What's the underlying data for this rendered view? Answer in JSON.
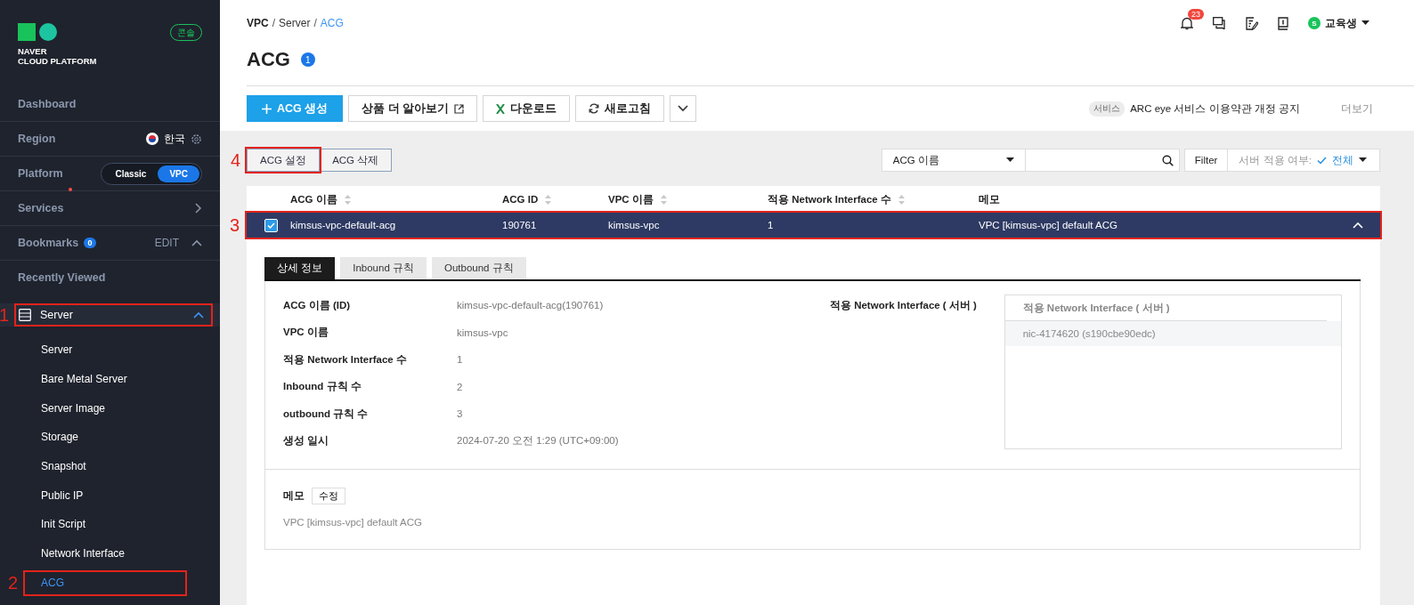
{
  "sidebar": {
    "logo": {
      "line1": "NAVER",
      "line2": "CLOUD PLATFORM"
    },
    "badge": "콘솔",
    "nav": [
      {
        "kind": "link",
        "label": "Dashboard"
      },
      {
        "kind": "region",
        "label": "Region",
        "value": "한국"
      },
      {
        "kind": "toggle",
        "label": "Platform",
        "options": [
          {
            "label": "Classic",
            "selected": false
          },
          {
            "label": "VPC",
            "selected": true
          }
        ]
      },
      {
        "kind": "services",
        "label": "Services",
        "dot": true
      },
      {
        "kind": "bookmarks",
        "label": "Bookmarks",
        "count": "0",
        "action": "EDIT",
        "expanded": true
      },
      {
        "kind": "heading",
        "label": "Recently Viewed"
      }
    ],
    "menu": {
      "label": "Server",
      "expanded": true,
      "annotation": "1",
      "children": [
        {
          "label": "Server",
          "selected": false
        },
        {
          "label": "Bare Metal Server",
          "selected": false
        },
        {
          "label": "Server Image",
          "selected": false
        },
        {
          "label": "Storage",
          "selected": false
        },
        {
          "label": "Snapshot",
          "selected": false
        },
        {
          "label": "Public IP",
          "selected": false
        },
        {
          "label": "Init Script",
          "selected": false
        },
        {
          "label": "Network Interface",
          "selected": false
        },
        {
          "label": "ACG",
          "selected": true,
          "annotation": "2"
        }
      ]
    }
  },
  "header": {
    "breadcrumb": [
      {
        "label": "VPC",
        "kind": "root",
        "separator": "/"
      },
      {
        "label": "Server",
        "kind": "link",
        "separator": "/"
      },
      {
        "label": "ACG",
        "kind": "current"
      }
    ],
    "title": "ACG",
    "count": "1",
    "notifications": "23",
    "user": {
      "initial": "S",
      "name": "교육생"
    }
  },
  "toolbar": {
    "buttons": [
      {
        "kind": "primary",
        "label": "ACG 생성"
      },
      {
        "kind": "external",
        "label": "상품 더 알아보기"
      },
      {
        "kind": "excel",
        "label": "다운로드"
      },
      {
        "kind": "refresh",
        "label": "새로고침"
      },
      {
        "kind": "more"
      }
    ],
    "notice": {
      "tag": "서비스",
      "text": "ARC eye 서비스 이용약관 개정 공지",
      "more": "더보기"
    }
  },
  "actions": [
    {
      "label": "ACG 설정",
      "annotation": "4"
    },
    {
      "label": "ACG 삭제"
    }
  ],
  "search": {
    "select": "ACG 이름",
    "filter": "Filter",
    "filter_label": "서버 적용 여부:",
    "filter_value": "전체"
  },
  "table": {
    "columns": [
      {
        "label": "ACG 이름",
        "sortable": true
      },
      {
        "label": "ACG ID",
        "sortable": true
      },
      {
        "label": "VPC 이름",
        "sortable": true
      },
      {
        "label": "적용 Network Interface 수",
        "sortable": true
      },
      {
        "label": "메모",
        "sortable": false
      }
    ],
    "rows": [
      {
        "checked": true,
        "selected": true,
        "expanded": true,
        "annotation": "3",
        "cells": [
          "kimsus-vpc-default-acg",
          "190761",
          "kimsus-vpc",
          "1",
          "VPC [kimsus-vpc] default ACG"
        ]
      }
    ]
  },
  "detail": {
    "tabs": [
      {
        "label": "상세 정보",
        "selected": true
      },
      {
        "label": "Inbound 규칙",
        "selected": false
      },
      {
        "label": "Outbound 규칙",
        "selected": false
      }
    ],
    "fields": [
      {
        "label": "ACG 이름 (ID)",
        "value": "kimsus-vpc-default-acg(190761)"
      },
      {
        "label": "VPC 이름",
        "value": "kimsus-vpc"
      },
      {
        "label": "적용 Network Interface 수",
        "value": "1"
      },
      {
        "label": "Inbound 규칙 수",
        "value": "2"
      },
      {
        "label": "outbound 규칙 수",
        "value": "3"
      },
      {
        "label": "생성 일시",
        "value": "2024-07-20 오전 1:29 (UTC+09:00)"
      }
    ],
    "interfaces": {
      "label": "적용 Network Interface ( 서버 )",
      "header": "적용 Network Interface ( 서버 )",
      "items": [
        "nic-4174620 (s190cbe90edc)"
      ]
    },
    "memo": {
      "label": "메모",
      "edit": "수정",
      "text": "VPC [kimsus-vpc] default ACG"
    }
  }
}
